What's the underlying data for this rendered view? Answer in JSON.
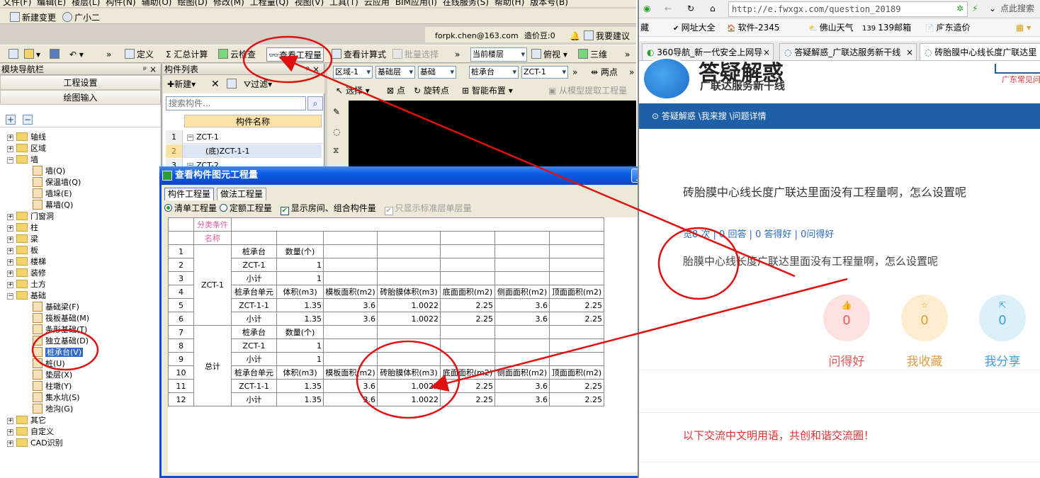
{
  "menubar": [
    "文件(F)",
    "编辑(E)",
    "楼层(L)",
    "构件(N)",
    "辅助(O)",
    "绘图(D)",
    "修改(M)",
    "工程量(Q)",
    "视图(V)",
    "工具(T)",
    "云应用",
    "BIM应用(I)",
    "在线服务(S)",
    "帮助(H)",
    "版本号(B)"
  ],
  "toolbar1": {
    "new_change": "新建变更",
    "assistant": "广小二"
  },
  "userbar": {
    "email": "forpk.chen@163.com",
    "price": "造价豆:0",
    "suggest": "我要建议"
  },
  "toolbar2": {
    "define": "定义",
    "sum_calc": "汇总计算",
    "cloud_check": "云检查",
    "view_qty": "查看工程量",
    "view_formula": "查看计算式",
    "batch_select": "批量选择",
    "floor_combo": "当前楼层",
    "view_mode": "俯视",
    "three_d": "三维"
  },
  "nav": {
    "title": "模块导航栏",
    "project_settings": "工程设置",
    "drawing_input": "绘图输入",
    "tree": [
      {
        "label": "轴线",
        "level": 0
      },
      {
        "label": "区域",
        "level": 0
      },
      {
        "label": "墙",
        "level": 0
      },
      {
        "label": "墙(Q)",
        "level": 1
      },
      {
        "label": "保温墙(Q)",
        "level": 1
      },
      {
        "label": "墙垛(E)",
        "level": 1
      },
      {
        "label": "幕墙(Q)",
        "level": 1
      },
      {
        "label": "门窗洞",
        "level": 0
      },
      {
        "label": "柱",
        "level": 0
      },
      {
        "label": "梁",
        "level": 0
      },
      {
        "label": "板",
        "level": 0
      },
      {
        "label": "楼梯",
        "level": 0
      },
      {
        "label": "装修",
        "level": 0
      },
      {
        "label": "土方",
        "level": 0
      },
      {
        "label": "基础",
        "level": 0
      },
      {
        "label": "基础梁(F)",
        "level": 1
      },
      {
        "label": "筏板基础(M)",
        "level": 1
      },
      {
        "label": "条形基础(T)",
        "level": 1
      },
      {
        "label": "独立基础(D)",
        "level": 1
      },
      {
        "label": "桩承台(V)",
        "level": 1
      },
      {
        "label": "桩(U)",
        "level": 1
      },
      {
        "label": "垫层(X)",
        "level": 1
      },
      {
        "label": "柱墩(Y)",
        "level": 1
      },
      {
        "label": "集水坑(S)",
        "level": 1
      },
      {
        "label": "地沟(G)",
        "level": 1
      },
      {
        "label": "其它",
        "level": 0
      },
      {
        "label": "自定义",
        "level": 0
      },
      {
        "label": "CAD识别",
        "level": 0
      }
    ]
  },
  "complist": {
    "title": "构件列表",
    "new": "新建",
    "filter": "过滤",
    "search_placeholder": "搜索构件...",
    "col_header": "构件名称",
    "rows": [
      {
        "n": "1",
        "name": "ZCT-1"
      },
      {
        "n": "2",
        "name": "(底)ZCT-1-1"
      },
      {
        "n": "3",
        "name": "ZCT-2"
      }
    ]
  },
  "drawbar": {
    "area": "区域-1",
    "layer": "基础层",
    "cat": "基础",
    "type": "桩承台",
    "item": "ZCT-1",
    "two_point": "两点",
    "select": "选择",
    "point": "点",
    "rotate_point": "旋转点",
    "smart_place": "智能布置",
    "extract": "从模型提取工程量"
  },
  "dialog": {
    "title": "查看构件图元工程量",
    "tab1": "构件工程量",
    "tab2": "做法工程量",
    "opt1": "清单工程量",
    "opt2": "定额工程量",
    "opt3": "显示房间、组合构件量",
    "opt4": "只显示标准层单层量",
    "hdr_cat": "分类条件",
    "hdr_name": "名称",
    "hdr_qty": "工程量名称",
    "col_nums": [
      "1",
      "2",
      "3",
      "4",
      "5",
      "6"
    ],
    "groups": [
      "ZCT-1",
      "总计"
    ],
    "rows": [
      [
        "1",
        "桩承台",
        "数量(个)",
        "",
        "",
        "",
        "",
        ""
      ],
      [
        "2",
        "ZCT-1",
        "1",
        "",
        "",
        "",
        "",
        ""
      ],
      [
        "3",
        "小计",
        "1",
        "",
        "",
        "",
        "",
        ""
      ],
      [
        "4",
        "桩承台单元",
        "体积(m3)",
        "模板面积(m2)",
        "砖胎膜体积(m3)",
        "底面面积(m2)",
        "侧面面积(m2)",
        "顶面面积(m2)"
      ],
      [
        "5",
        "ZCT-1-1",
        "1.35",
        "3.6",
        "1.0022",
        "2.25",
        "3.6",
        "2.25"
      ],
      [
        "6",
        "小计",
        "1.35",
        "3.6",
        "1.0022",
        "2.25",
        "3.6",
        "2.25"
      ],
      [
        "7",
        "桩承台",
        "数量(个)",
        "",
        "",
        "",
        "",
        ""
      ],
      [
        "8",
        "ZCT-1",
        "1",
        "",
        "",
        "",
        "",
        ""
      ],
      [
        "9",
        "小计",
        "1",
        "",
        "",
        "",
        "",
        ""
      ],
      [
        "10",
        "桩承台单元",
        "体积(m3)",
        "模板面积(m2)",
        "砖胎膜体积(m3)",
        "底面面积(m2)",
        "侧面面积(m2)",
        "顶面面积(m2)"
      ],
      [
        "11",
        "ZCT-1-1",
        "1.35",
        "3.6",
        "1.0022",
        "2.25",
        "3.6",
        "2.25"
      ],
      [
        "12",
        "小计",
        "1.35",
        "3.6",
        "1.0022",
        "2.25",
        "3.6",
        "2.25"
      ]
    ]
  },
  "browser": {
    "url": "http://e.fwxgx.com/question_20189",
    "search_ph": "点此搜索",
    "fav": [
      "藏",
      "网址大全",
      "软件-2345",
      "佛山天气",
      "139邮箱",
      "广东造价"
    ],
    "tabs": [
      "360导航_新一代安全上网导",
      "答疑解惑_广联达服务新干线",
      "砖胎膜中心线长度广联达里"
    ],
    "site_title": "答疑解惑",
    "site_sub": "广联达服务新干线",
    "site_right": "广东常见问",
    "crumb": "答疑解惑 \\我来搜 \\问题详情",
    "q_title": "砖胎膜中心线长度广联达里面没有工程量啊，怎么设置呢",
    "q_stats": "览8 次 | 0 回答 | 0 答得好 | 0问得好",
    "q_body": "胎膜中心线长度广联达里面没有工程量啊，怎么设置呢",
    "like_count": "0",
    "fav_count": "0",
    "share_count": "0",
    "like_label": "问得好",
    "fav_label": "我收藏",
    "share_label": "我分享",
    "notice": "以下交流中文明用语，共创和谐交流圈！"
  },
  "colors": {
    "annotation": "#e01010",
    "title_blue": "#0a5de4",
    "header_blue": "#8db3e2",
    "crumb": "#1e5fa8"
  }
}
